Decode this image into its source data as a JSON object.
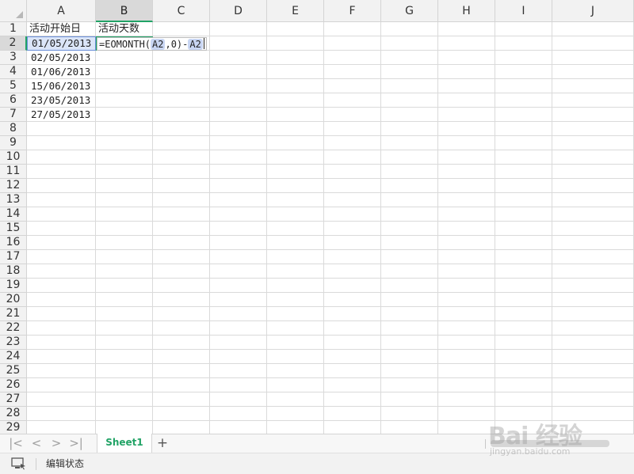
{
  "columns": [
    "A",
    "B",
    "C",
    "D",
    "E",
    "F",
    "G",
    "H",
    "I",
    "J"
  ],
  "rows": [
    "1",
    "2",
    "3",
    "4",
    "5",
    "6",
    "7",
    "8",
    "9",
    "10",
    "11",
    "12",
    "13",
    "14",
    "15",
    "16",
    "17",
    "18",
    "19",
    "20",
    "21",
    "22",
    "23",
    "24",
    "25",
    "26",
    "27",
    "28",
    "29"
  ],
  "selected_column": "B",
  "selected_row": "2",
  "cells": {
    "A1": "活动开始日",
    "B1": "活动天数",
    "A3": "02/05/2013",
    "A4": "01/06/2013",
    "A5": "15/06/2013",
    "A6": "23/05/2013",
    "A7": "27/05/2013"
  },
  "referenced_cell": {
    "address": "A2",
    "value": "01/05/2013"
  },
  "editing": {
    "cell": "B2",
    "prefix": "=EOMONTH(",
    "ref1": "A2",
    "middle": ",0)-",
    "ref2": "A2"
  },
  "tabbar": {
    "nav_first": "|<",
    "nav_prev": "<",
    "nav_next": ">",
    "nav_last": ">|",
    "active_sheet": "Sheet1",
    "add_sheet": "+"
  },
  "statusbar": {
    "mode_text": "编辑状态"
  },
  "watermark": {
    "text": "Bai 经验",
    "sub": "jingyan.baidu.com"
  },
  "colors": {
    "accent": "#21a366",
    "ref_highlight": "#dbe5f8",
    "ref_border": "#6a8fd8"
  }
}
